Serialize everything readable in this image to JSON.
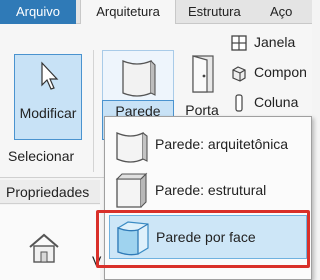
{
  "tabs": [
    {
      "label": "Arquivo"
    },
    {
      "label": "Arquitetura"
    },
    {
      "label": "Estrutura"
    },
    {
      "label": "Aço"
    }
  ],
  "ribbon": {
    "modify_label": "Modificar",
    "select_label": "Selecionar",
    "wall_label": "Parede",
    "door_label": "Porta",
    "window_label": "Janela",
    "component_label": "Compon",
    "column_label": "Coluna"
  },
  "properties": {
    "title": "Propriedades",
    "cut_text": "V"
  },
  "wall_menu": {
    "items": [
      {
        "label": "Parede: arquitetônica"
      },
      {
        "label": "Parede: estrutural"
      },
      {
        "label": "Parede por face"
      }
    ]
  },
  "colors": {
    "file_tab": "#2f7ab7",
    "selected_button": "#c8e2f6",
    "highlight_border": "#d9302a"
  }
}
